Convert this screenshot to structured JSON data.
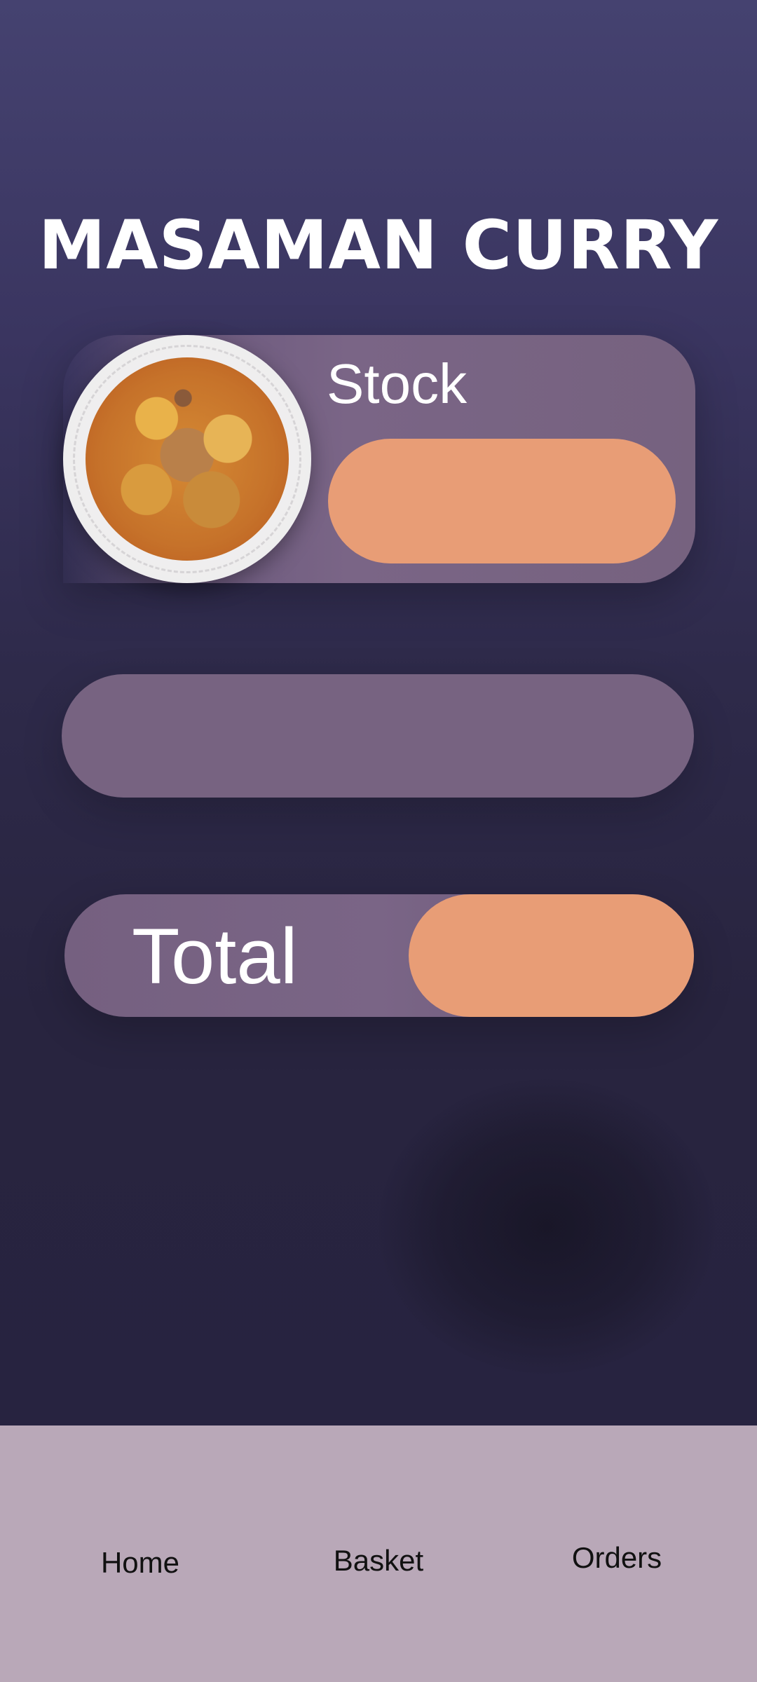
{
  "header": {
    "title": "MASAMAN CURRY"
  },
  "product": {
    "image_icon": "curry-dish-photo",
    "stock_label": "Stock"
  },
  "summary": {
    "total_label": "Total"
  },
  "nav": {
    "home": "Home",
    "basket": "Basket",
    "orders": "Orders"
  },
  "colors": {
    "background": "#2e2a4a",
    "card": "#7a6586",
    "accent": "#e89d76",
    "nav_background": "#b9a8b8"
  }
}
